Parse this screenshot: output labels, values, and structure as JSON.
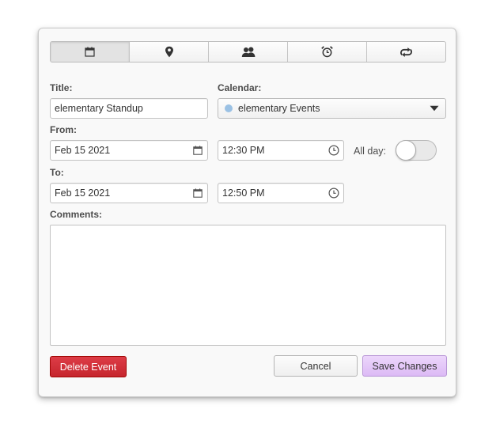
{
  "tabs": [
    {
      "name": "calendar-icon",
      "active": true
    },
    {
      "name": "location-pin-icon",
      "active": false
    },
    {
      "name": "guests-icon",
      "active": false
    },
    {
      "name": "alarm-clock-icon",
      "active": false
    },
    {
      "name": "repeat-icon",
      "active": false
    }
  ],
  "form": {
    "title_label": "Title:",
    "title_value": "elementary Standup",
    "calendar_label": "Calendar:",
    "calendar_value": "elementary Events",
    "calendar_color": "#9bc1e4",
    "from_label": "From:",
    "from_date": "Feb 15 2021",
    "from_time": "12:30 PM",
    "allday_label": "All day:",
    "allday_on": false,
    "to_label": "To:",
    "to_date": "Feb 15 2021",
    "to_time": "12:50 PM",
    "comments_label": "Comments:",
    "comments_value": ""
  },
  "buttons": {
    "delete_label": "Delete Event",
    "cancel_label": "Cancel",
    "save_label": "Save Changes"
  },
  "colors": {
    "destructive": "#c6262e",
    "suggested": "#dcbaf5"
  }
}
